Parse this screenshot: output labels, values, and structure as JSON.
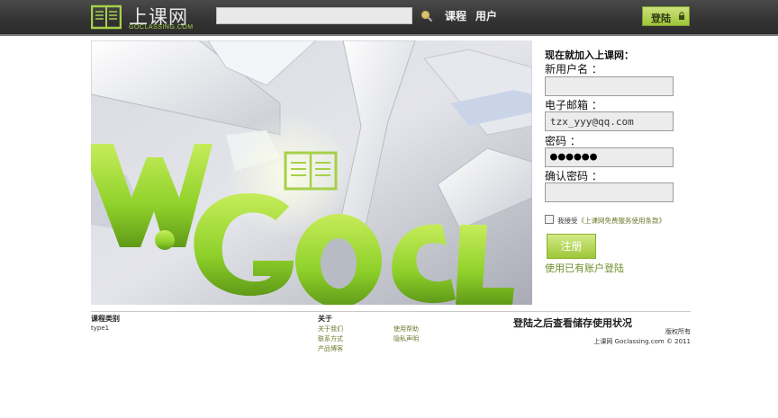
{
  "header": {
    "logo_text": "上课网",
    "logo_sub": "GOCLASSING.COM",
    "search_value": "",
    "nav": [
      "课程",
      "用户"
    ],
    "login_label": "登陆"
  },
  "form": {
    "title": "现在就加入上课网：",
    "username_label": "新用户名 ：",
    "username_value": "",
    "email_label": "电子邮箱 ：",
    "email_value": "tzx_yyy@qq.com",
    "password_label": "密码 ：",
    "password_value": "●●●●●●",
    "confirm_label": "确认密码 ：",
    "confirm_value": "",
    "agree_prefix": "我接受",
    "agree_link": "《上课网免费服务使用条款》",
    "register_label": "注册",
    "existing_login": "使用已有账户登陆"
  },
  "footer": {
    "category_title": "课程类别",
    "category_items": [
      "type1"
    ],
    "about_title": "关于",
    "about_col1": [
      "关于我们",
      "联系方式",
      "产品博客"
    ],
    "about_col2": [
      "使用帮助",
      "隐私声明"
    ],
    "usage_title": "登陆之后查看储存使用状况",
    "rights": "版权所有",
    "copyright": "上课网 Goclassing.com © 2011"
  },
  "colors": {
    "accent_green": "#9fc53a",
    "header_bg": "#333333",
    "link_green": "#6a7b2c"
  }
}
